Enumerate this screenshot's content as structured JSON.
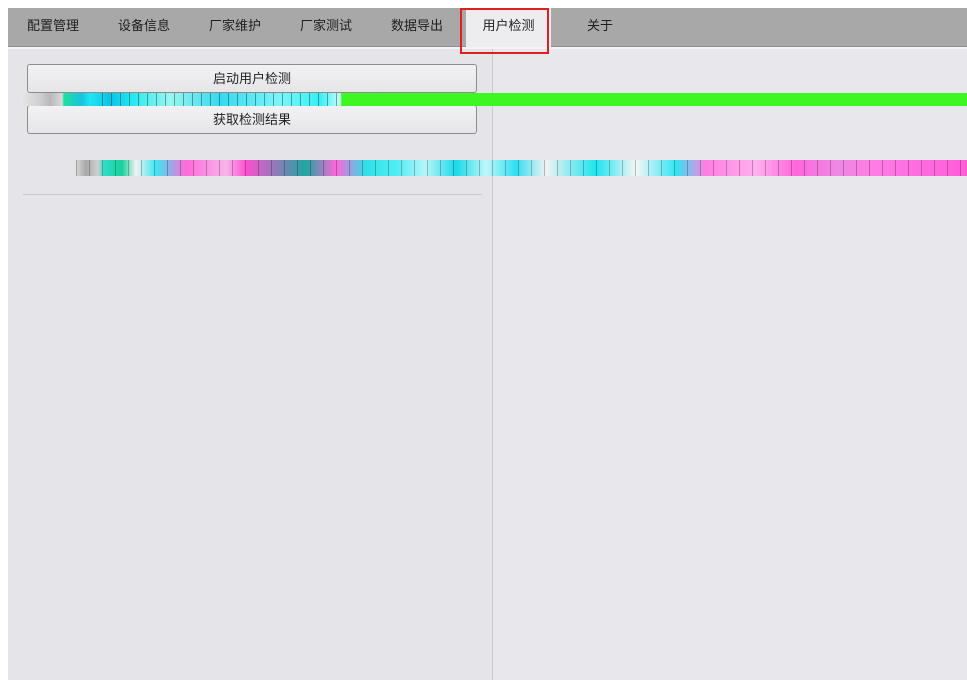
{
  "tabs": [
    {
      "label": "配置管理",
      "active": false
    },
    {
      "label": "设备信息",
      "active": false
    },
    {
      "label": "厂家维护",
      "active": false
    },
    {
      "label": "厂家测试",
      "active": false
    },
    {
      "label": "数据导出",
      "active": false
    },
    {
      "label": "用户检测",
      "active": true
    },
    {
      "label": "关于",
      "active": false
    }
  ],
  "actions": {
    "start_label": "启动用户检测",
    "result_label": "获取检测结果"
  },
  "colors": {
    "tabbar_bg": "#a8a8a8",
    "panel_bg": "#e4e4e9",
    "highlight_border": "#e02020",
    "glitch_green": "#3ef722",
    "glitch_cyan": "#1ee7f0",
    "glitch_magenta": "#ff66dc"
  }
}
